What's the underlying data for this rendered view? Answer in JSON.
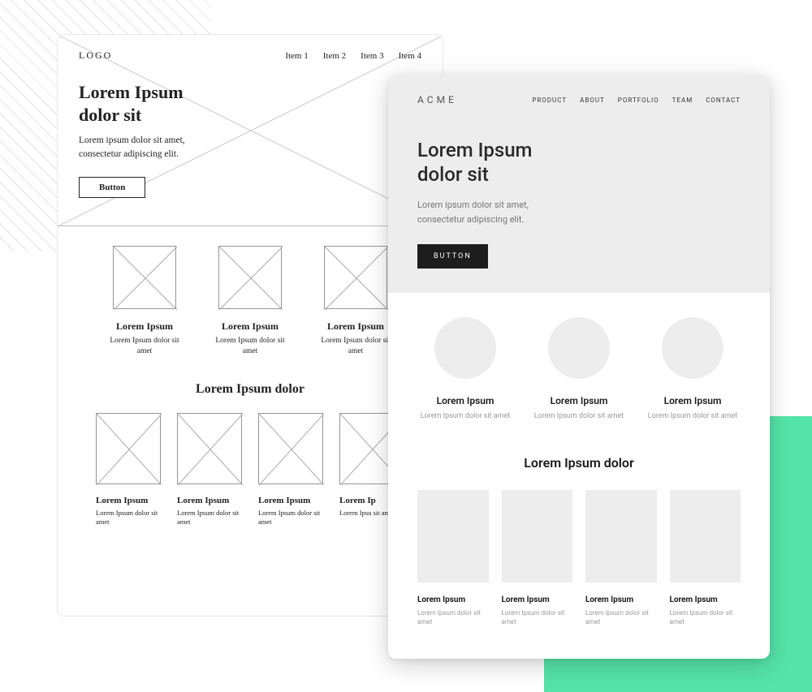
{
  "wireframe": {
    "logo": "LOGO",
    "nav": [
      "Item 1",
      "Item 2",
      "Item 3",
      "Item 4"
    ],
    "hero": {
      "title_l1": "Lorem Ipsum",
      "title_l2": "dolor sit",
      "subtitle_l1": "Lorem ipsum dolor sit amet,",
      "subtitle_l2": "consectetur adipiscing elit.",
      "button": "Button"
    },
    "features": [
      {
        "title": "Lorem Ipsum",
        "sub": "Lorem Ipsum dolor sit amet"
      },
      {
        "title": "Lorem Ipsum",
        "sub": "Lorem Ipsum dolor sit amet"
      },
      {
        "title": "Lorem Ipsum",
        "sub": "Lorem Ipsum dolor sit amet"
      }
    ],
    "section2_heading": "Lorem Ipsum dolor",
    "cards4": [
      {
        "title": "Lorem Ipsum",
        "sub": "Lorem Ipsum dolor sit amet"
      },
      {
        "title": "Lorem Ipsum",
        "sub": "Lorem Ipsum dolor sit amet"
      },
      {
        "title": "Lorem Ipsum",
        "sub": "Lorem Ipsum dolor sit amet"
      },
      {
        "title": "Lorem Ip",
        "sub": "Lorem Ipsu sit amet"
      }
    ]
  },
  "mockup": {
    "logo": "ACME",
    "nav": [
      "PRODUCT",
      "ABOUT",
      "PORTFOLIO",
      "TEAM",
      "CONTACT"
    ],
    "hero": {
      "title_l1": "Lorem Ipsum",
      "title_l2": "dolor sit",
      "subtitle_l1": "Lorem ipsum dolor sit amet,",
      "subtitle_l2": "consectetur adipiscing elit.",
      "button": "BUTTON"
    },
    "features": [
      {
        "title": "Lorem Ipsum",
        "sub": "Lorem Ipsum dolor sit amet"
      },
      {
        "title": "Lorem Ipsum",
        "sub": "Lorem Ipsum dolor sit amet"
      },
      {
        "title": "Lorem Ipsum",
        "sub": "Lorem Ipsum dolor sit amet"
      }
    ],
    "section2_heading": "Lorem Ipsum dolor",
    "cards4": [
      {
        "title": "Lorem Ipsum",
        "sub": "Lorem Ipsum dolor sit amet"
      },
      {
        "title": "Lorem Ipsum",
        "sub": "Lorem Ipsum dolor sit amet"
      },
      {
        "title": "Lorem Ipsum",
        "sub": "Lorem Ipsum dolor sit amet"
      },
      {
        "title": "Lorem Ipsum",
        "sub": "Lorem Ipsum dolor sit amet"
      }
    ]
  }
}
